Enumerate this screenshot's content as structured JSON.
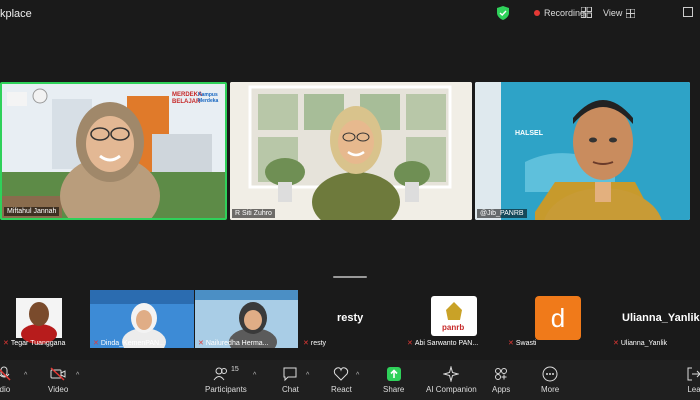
{
  "window": {
    "title": "kplace"
  },
  "header": {
    "recording_label": "Recording",
    "view_label": "View"
  },
  "speakers": [
    {
      "name": "Miftahul Jannah",
      "slide_text_1": "MERDEKA BELAJAR",
      "slide_text_2": "Kampus Merdeka"
    },
    {
      "name": "R Siti Zuhro"
    },
    {
      "name": "@Jib_PANRB",
      "slide_text": "HALSEL"
    }
  ],
  "gallery": [
    {
      "name": "Tegar Tuanggana"
    },
    {
      "name": "Dinda_KemenPAN..."
    },
    {
      "name": "Nailuredha Herma..."
    },
    {
      "name": "resty",
      "display": "resty"
    },
    {
      "name": "Abi Sarwanto PAN...",
      "logo_text": "panrb"
    },
    {
      "name": "Swasti",
      "avatar_letter": "d"
    },
    {
      "name": "Ulianna_Yanlik",
      "display": "Ulianna_Yanlik"
    }
  ],
  "toolbar": {
    "audio_label": "idio",
    "video_label": "Video",
    "participants_label": "Participants",
    "participants_count": "15",
    "chat_label": "Chat",
    "react_label": "React",
    "share_label": "Share",
    "ai_label": "AI Companion",
    "apps_label": "Apps",
    "more_label": "More",
    "leave_label": "Lea"
  },
  "colors": {
    "share_green": "#2fd15a",
    "record_red": "#e53935",
    "avatar_orange": "#f07a1a",
    "speaker_border": "#2fd15a"
  }
}
